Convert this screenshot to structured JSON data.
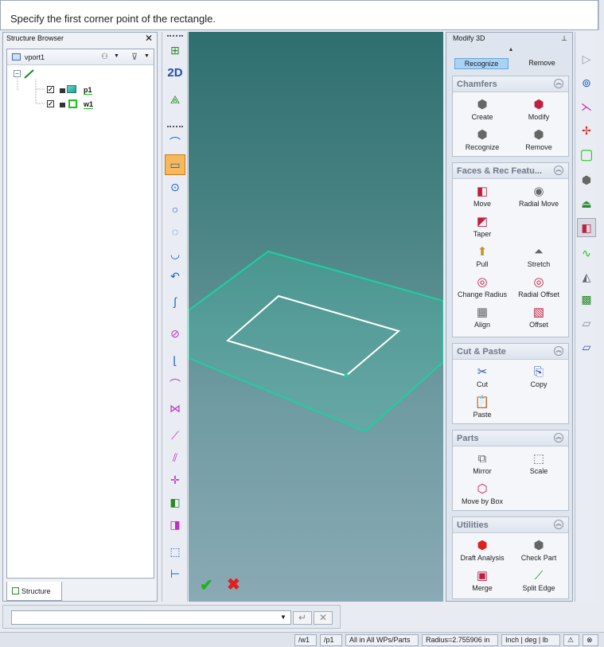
{
  "prompt": {
    "text": "Specify the first corner point of the rectangle."
  },
  "structure_browser": {
    "title": "Structure Browser",
    "close": "✕",
    "viewport_label": "vport1",
    "nodes": [
      {
        "label": "p1",
        "checked": "✓"
      },
      {
        "label": "w1",
        "checked": "✓"
      }
    ],
    "tab_label": "Structure"
  },
  "left_toolbar": {
    "mode_2d": "2D"
  },
  "viewport": {
    "ok_symbol": "✔",
    "cancel_symbol": "✖",
    "colors": {
      "workplane": "#1bd1a0",
      "rectangle": "#ffffff"
    }
  },
  "modify3d": {
    "title": "Modify 3D",
    "pin": "📌",
    "top_row": {
      "recognize": "Recognize",
      "remove": "Remove"
    },
    "groups": {
      "chamfers": {
        "title": "Chamfers",
        "buttons": [
          "Create",
          "Modify",
          "Recognize",
          "Remove"
        ]
      },
      "faces": {
        "title": "Faces & Rec Featu...",
        "buttons": [
          "Move",
          "Radial Move",
          "Taper",
          "Pull",
          "Stretch",
          "Change Radius",
          "Radial Offset",
          "Align",
          "Offset"
        ]
      },
      "cut_paste": {
        "title": "Cut & Paste",
        "buttons": [
          "Cut",
          "Copy",
          "Paste"
        ]
      },
      "parts": {
        "title": "Parts",
        "buttons": [
          "Mirror",
          "Scale",
          "Move by Box"
        ]
      },
      "utilities": {
        "title": "Utilities",
        "buttons": [
          "Draft Analysis",
          "Check Part",
          "Merge",
          "Split Edge"
        ]
      }
    }
  },
  "command_bar": {
    "input_value": "",
    "enter_symbol": "↵",
    "cancel_symbol": "✕"
  },
  "status_bar": {
    "wp": "/w1",
    "part": "/p1",
    "scope": "All in All WPs/Parts",
    "radius": "Radius=2.755906 in",
    "units": "Inch | deg | lb",
    "warning": "⚠",
    "extra": "⊗"
  }
}
